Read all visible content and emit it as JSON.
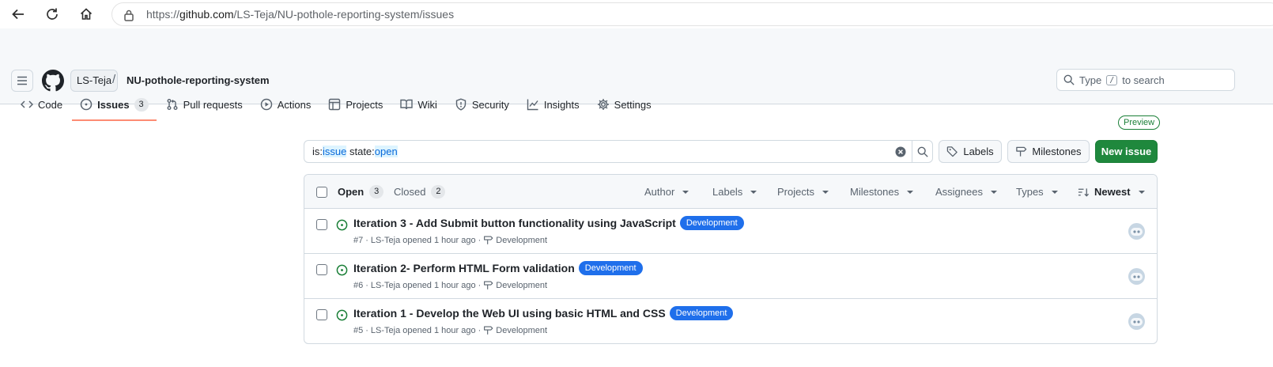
{
  "browser": {
    "url_prefix": "https://",
    "url_host": "github.com",
    "url_path": "/LS-Teja/NU-pothole-reporting-system/issues"
  },
  "header": {
    "owner": "LS-Teja",
    "separator": "/",
    "repo": "NU-pothole-reporting-system",
    "search_prefix": "Type",
    "search_key": "/",
    "search_suffix": "to search"
  },
  "tabs": [
    {
      "label": "Code",
      "icon": "code-icon"
    },
    {
      "label": "Issues",
      "icon": "issue-opened-icon",
      "count": "3",
      "active": true
    },
    {
      "label": "Pull requests",
      "icon": "git-pull-request-icon"
    },
    {
      "label": "Actions",
      "icon": "play-icon"
    },
    {
      "label": "Projects",
      "icon": "table-icon"
    },
    {
      "label": "Wiki",
      "icon": "book-icon"
    },
    {
      "label": "Security",
      "icon": "shield-icon"
    },
    {
      "label": "Insights",
      "icon": "graph-icon"
    },
    {
      "label": "Settings",
      "icon": "gear-icon"
    }
  ],
  "toolbar": {
    "preview": "Preview",
    "query_1": "is:",
    "query_2": "issue",
    "query_3": " state:",
    "query_4": "open",
    "labels_button": "Labels",
    "milestones_button": "Milestones",
    "new_issue_button": "New issue"
  },
  "list_header": {
    "open_label": "Open",
    "open_count": "3",
    "closed_label": "Closed",
    "closed_count": "2",
    "filters": [
      "Author",
      "Labels",
      "Projects",
      "Milestones",
      "Assignees",
      "Types"
    ],
    "sort": "Newest"
  },
  "issues": [
    {
      "title": "Iteration 3 - Add Submit button functionality using JavaScript",
      "label": "Development",
      "number": "#7",
      "author": "LS-Teja",
      "opened": "opened 1 hour ago",
      "milestone": "Development"
    },
    {
      "title": "Iteration 2- Perform HTML Form validation",
      "label": "Development",
      "number": "#6",
      "author": "LS-Teja",
      "opened": "opened 1 hour ago",
      "milestone": "Development"
    },
    {
      "title": "Iteration 1 - Develop the Web UI using basic HTML and CSS",
      "label": "Development",
      "number": "#5",
      "author": "LS-Teja",
      "opened": "opened 1 hour ago",
      "milestone": "Development"
    }
  ],
  "colors": {
    "accent_green": "#1f883d",
    "label_blue": "#1f6feb",
    "active_tab_underline": "#fd8c73",
    "open_issue_green": "#1a7f37"
  }
}
